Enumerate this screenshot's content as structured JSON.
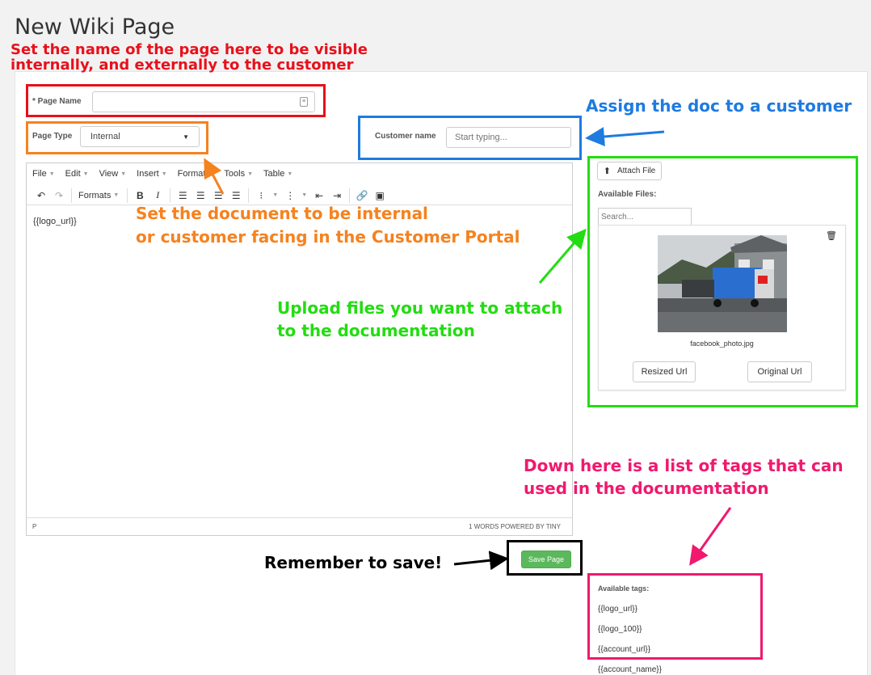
{
  "page_title": "New Wiki Page",
  "form": {
    "page_name_label": "* Page Name",
    "page_name_value": "",
    "page_type_label": "Page Type",
    "page_type_value": "Internal",
    "customer_name_label": "Customer name",
    "customer_name_placeholder": "Start typing..."
  },
  "editor": {
    "menus": [
      "File",
      "Edit",
      "View",
      "Insert",
      "Format",
      "Tools",
      "Table"
    ],
    "formats_label": "Formats",
    "content": "{{logo_url}}",
    "status_path": "P",
    "status_words": "1 WORDS POWERED BY TINY"
  },
  "files": {
    "attach_label": "Attach File",
    "available_label": "Available Files:",
    "search_placeholder": "Search...",
    "file_name": "facebook_photo.jpg",
    "resized_label": "Resized Url",
    "original_label": "Original Url"
  },
  "save_label": "Save Page",
  "tags": {
    "heading": "Available tags:",
    "items": [
      "{{logo_url}}",
      "{{logo_100}}",
      "{{account_url}}",
      "{{account_name}}"
    ]
  },
  "annotations": {
    "name_note_1": "Set the name of the page here to be visible",
    "name_note_2": "internally, and externally to the customer",
    "customer_note": "Assign the doc to a customer",
    "type_note_1": "Set the document to be internal",
    "type_note_2": "or customer facing in the Customer Portal",
    "upload_note_1": "Upload files you want to attach",
    "upload_note_2": "to the documentation",
    "tags_note_1": "Down here is a list of tags that can",
    "tags_note_2": "used in the documentation",
    "save_note": "Remember to save!"
  },
  "colors": {
    "red": "#e8101a",
    "orange": "#f5821f",
    "blue": "#1e7be0",
    "green": "#22dd11",
    "pink": "#f0196e",
    "black": "#000000",
    "save_green": "#5cb85c"
  }
}
